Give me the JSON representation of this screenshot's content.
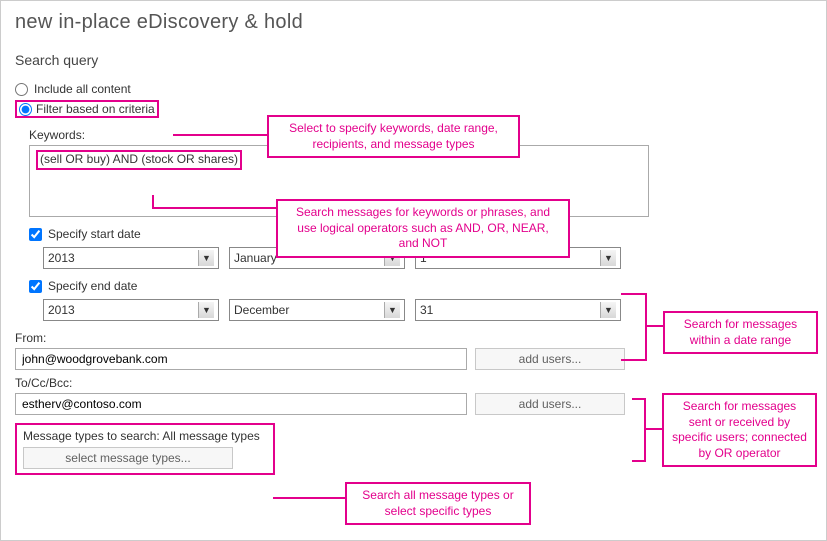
{
  "page_title": "new in-place eDiscovery & hold",
  "section_heading": "Search query",
  "radios": {
    "include_all": "Include all content",
    "filter_criteria": "Filter based on criteria"
  },
  "annotations": {
    "criteria": "Select to specify keywords, date range, recipients, and message types",
    "keywords": "Search messages for keywords or phrases, and use logical operators such as AND, OR, NEAR, and NOT",
    "date_range": "Search for messages within a date range",
    "users": "Search for messages sent or received by specific users; connected by OR operator",
    "msg_types": "Search all message types or select specific types"
  },
  "keywords": {
    "label": "Keywords:",
    "value": "(sell OR buy) AND (stock OR shares)"
  },
  "start_date": {
    "label": "Specify start date",
    "year": "2013",
    "month": "January",
    "day": "1"
  },
  "end_date": {
    "label": "Specify end date",
    "year": "2013",
    "month": "December",
    "day": "31"
  },
  "from": {
    "label": "From:",
    "value": "john@woodgrovebank.com",
    "button": "add users..."
  },
  "tocc": {
    "label": "To/Cc/Bcc:",
    "value": "estherv@contoso.com",
    "button": "add users..."
  },
  "msg_types": {
    "label": "Message types to search:  All message types",
    "button": "select message types..."
  }
}
